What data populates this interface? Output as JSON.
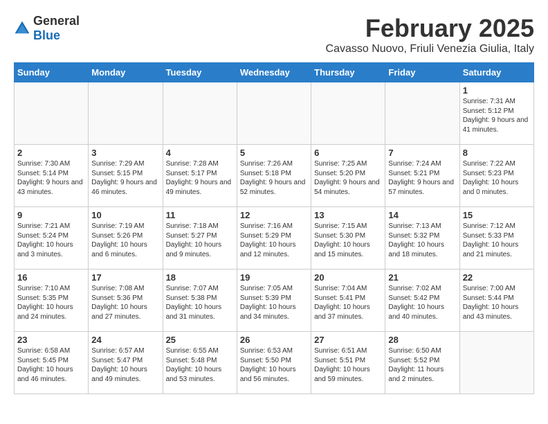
{
  "logo": {
    "general": "General",
    "blue": "Blue"
  },
  "title": "February 2025",
  "subtitle": "Cavasso Nuovo, Friuli Venezia Giulia, Italy",
  "days_of_week": [
    "Sunday",
    "Monday",
    "Tuesday",
    "Wednesday",
    "Thursday",
    "Friday",
    "Saturday"
  ],
  "weeks": [
    [
      {
        "day": "",
        "info": ""
      },
      {
        "day": "",
        "info": ""
      },
      {
        "day": "",
        "info": ""
      },
      {
        "day": "",
        "info": ""
      },
      {
        "day": "",
        "info": ""
      },
      {
        "day": "",
        "info": ""
      },
      {
        "day": "1",
        "info": "Sunrise: 7:31 AM\nSunset: 5:12 PM\nDaylight: 9 hours and 41 minutes."
      }
    ],
    [
      {
        "day": "2",
        "info": "Sunrise: 7:30 AM\nSunset: 5:14 PM\nDaylight: 9 hours and 43 minutes."
      },
      {
        "day": "3",
        "info": "Sunrise: 7:29 AM\nSunset: 5:15 PM\nDaylight: 9 hours and 46 minutes."
      },
      {
        "day": "4",
        "info": "Sunrise: 7:28 AM\nSunset: 5:17 PM\nDaylight: 9 hours and 49 minutes."
      },
      {
        "day": "5",
        "info": "Sunrise: 7:26 AM\nSunset: 5:18 PM\nDaylight: 9 hours and 52 minutes."
      },
      {
        "day": "6",
        "info": "Sunrise: 7:25 AM\nSunset: 5:20 PM\nDaylight: 9 hours and 54 minutes."
      },
      {
        "day": "7",
        "info": "Sunrise: 7:24 AM\nSunset: 5:21 PM\nDaylight: 9 hours and 57 minutes."
      },
      {
        "day": "8",
        "info": "Sunrise: 7:22 AM\nSunset: 5:23 PM\nDaylight: 10 hours and 0 minutes."
      }
    ],
    [
      {
        "day": "9",
        "info": "Sunrise: 7:21 AM\nSunset: 5:24 PM\nDaylight: 10 hours and 3 minutes."
      },
      {
        "day": "10",
        "info": "Sunrise: 7:19 AM\nSunset: 5:26 PM\nDaylight: 10 hours and 6 minutes."
      },
      {
        "day": "11",
        "info": "Sunrise: 7:18 AM\nSunset: 5:27 PM\nDaylight: 10 hours and 9 minutes."
      },
      {
        "day": "12",
        "info": "Sunrise: 7:16 AM\nSunset: 5:29 PM\nDaylight: 10 hours and 12 minutes."
      },
      {
        "day": "13",
        "info": "Sunrise: 7:15 AM\nSunset: 5:30 PM\nDaylight: 10 hours and 15 minutes."
      },
      {
        "day": "14",
        "info": "Sunrise: 7:13 AM\nSunset: 5:32 PM\nDaylight: 10 hours and 18 minutes."
      },
      {
        "day": "15",
        "info": "Sunrise: 7:12 AM\nSunset: 5:33 PM\nDaylight: 10 hours and 21 minutes."
      }
    ],
    [
      {
        "day": "16",
        "info": "Sunrise: 7:10 AM\nSunset: 5:35 PM\nDaylight: 10 hours and 24 minutes."
      },
      {
        "day": "17",
        "info": "Sunrise: 7:08 AM\nSunset: 5:36 PM\nDaylight: 10 hours and 27 minutes."
      },
      {
        "day": "18",
        "info": "Sunrise: 7:07 AM\nSunset: 5:38 PM\nDaylight: 10 hours and 31 minutes."
      },
      {
        "day": "19",
        "info": "Sunrise: 7:05 AM\nSunset: 5:39 PM\nDaylight: 10 hours and 34 minutes."
      },
      {
        "day": "20",
        "info": "Sunrise: 7:04 AM\nSunset: 5:41 PM\nDaylight: 10 hours and 37 minutes."
      },
      {
        "day": "21",
        "info": "Sunrise: 7:02 AM\nSunset: 5:42 PM\nDaylight: 10 hours and 40 minutes."
      },
      {
        "day": "22",
        "info": "Sunrise: 7:00 AM\nSunset: 5:44 PM\nDaylight: 10 hours and 43 minutes."
      }
    ],
    [
      {
        "day": "23",
        "info": "Sunrise: 6:58 AM\nSunset: 5:45 PM\nDaylight: 10 hours and 46 minutes."
      },
      {
        "day": "24",
        "info": "Sunrise: 6:57 AM\nSunset: 5:47 PM\nDaylight: 10 hours and 49 minutes."
      },
      {
        "day": "25",
        "info": "Sunrise: 6:55 AM\nSunset: 5:48 PM\nDaylight: 10 hours and 53 minutes."
      },
      {
        "day": "26",
        "info": "Sunrise: 6:53 AM\nSunset: 5:50 PM\nDaylight: 10 hours and 56 minutes."
      },
      {
        "day": "27",
        "info": "Sunrise: 6:51 AM\nSunset: 5:51 PM\nDaylight: 10 hours and 59 minutes."
      },
      {
        "day": "28",
        "info": "Sunrise: 6:50 AM\nSunset: 5:52 PM\nDaylight: 11 hours and 2 minutes."
      },
      {
        "day": "",
        "info": ""
      }
    ]
  ]
}
